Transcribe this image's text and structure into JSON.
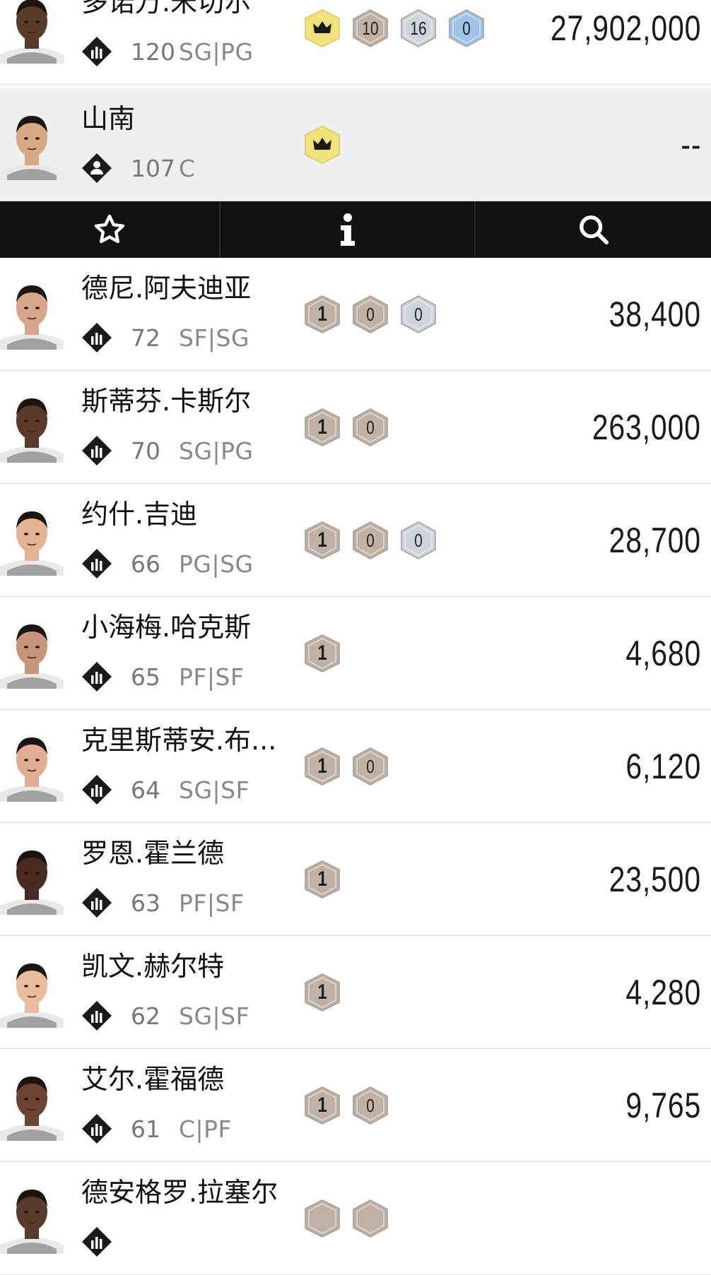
{
  "toolbar": {
    "buttons": [
      {
        "name": "favorite-star-icon"
      },
      {
        "name": "info-icon"
      },
      {
        "name": "search-icon"
      }
    ]
  },
  "colors": {
    "toolbar_bg": "#111111",
    "crown_badge": "#f2e27a",
    "bronze_badge": "#bfb1a6",
    "silver_badge": "#cfd3db",
    "gold_blue_badge": "#9ec3e6"
  },
  "players": [
    {
      "name": "多诺万.米切尔",
      "ovr": "120",
      "pos": "SG|PG",
      "role_icon": "bar-chart-icon",
      "badges": [
        {
          "type": "crown",
          "label": ""
        },
        {
          "type": "bronze",
          "label": "10"
        },
        {
          "type": "silver",
          "label": "16"
        },
        {
          "type": "blue",
          "label": "0"
        }
      ],
      "price": "27,902,000",
      "skin": "#5a3a28"
    },
    {
      "name": "山南",
      "ovr": "107",
      "pos": "C",
      "role_icon": "person-icon",
      "badges": [
        {
          "type": "crown",
          "label": ""
        }
      ],
      "price": "--",
      "skin": "#d9a982"
    },
    {
      "name": "德尼.阿夫迪亚",
      "ovr": "72",
      "pos": "SF|SG",
      "role_icon": "bar-chart-icon",
      "badges": [
        {
          "type": "tier1",
          "label": "1"
        },
        {
          "type": "bronze",
          "label": "0"
        },
        {
          "type": "silver",
          "label": "0"
        }
      ],
      "price": "38,400",
      "skin": "#d7a68a"
    },
    {
      "name": "斯蒂芬.卡斯尔",
      "ovr": "70",
      "pos": "SG|PG",
      "role_icon": "bar-chart-icon",
      "badges": [
        {
          "type": "tier1",
          "label": "1"
        },
        {
          "type": "bronze",
          "label": "0"
        }
      ],
      "price": "263,000",
      "skin": "#5b3a2a"
    },
    {
      "name": "约什.吉迪",
      "ovr": "66",
      "pos": "PG|SG",
      "role_icon": "bar-chart-icon",
      "badges": [
        {
          "type": "tier1",
          "label": "1"
        },
        {
          "type": "bronze",
          "label": "0"
        },
        {
          "type": "silver",
          "label": "0"
        }
      ],
      "price": "28,700",
      "skin": "#e3b394"
    },
    {
      "name": "小海梅.哈克斯",
      "ovr": "65",
      "pos": "PF|SF",
      "role_icon": "bar-chart-icon",
      "badges": [
        {
          "type": "tier1",
          "label": "1"
        }
      ],
      "price": "4,680",
      "skin": "#c9957a"
    },
    {
      "name": "克里斯蒂安.布...",
      "ovr": "64",
      "pos": "SG|SF",
      "role_icon": "bar-chart-icon",
      "badges": [
        {
          "type": "tier1",
          "label": "1"
        },
        {
          "type": "bronze",
          "label": "0"
        }
      ],
      "price": "6,120",
      "skin": "#e0ad92"
    },
    {
      "name": "罗恩.霍兰德",
      "ovr": "63",
      "pos": "PF|SF",
      "role_icon": "bar-chart-icon",
      "badges": [
        {
          "type": "tier1",
          "label": "1"
        }
      ],
      "price": "23,500",
      "skin": "#4a2b1f"
    },
    {
      "name": "凯文.赫尔特",
      "ovr": "62",
      "pos": "SG|SF",
      "role_icon": "bar-chart-icon",
      "badges": [
        {
          "type": "tier1",
          "label": "1"
        }
      ],
      "price": "4,280",
      "skin": "#eabd9f"
    },
    {
      "name": "艾尔.霍福德",
      "ovr": "61",
      "pos": "C|PF",
      "role_icon": "bar-chart-icon",
      "badges": [
        {
          "type": "tier1",
          "label": "1"
        },
        {
          "type": "bronze",
          "label": "0"
        }
      ],
      "price": "9,765",
      "skin": "#6b4330"
    },
    {
      "name": "德安格罗.拉塞尔",
      "ovr": "",
      "pos": "",
      "role_icon": "bar-chart-icon",
      "badges": [
        {
          "type": "tier1",
          "label": ""
        },
        {
          "type": "bronze",
          "label": ""
        }
      ],
      "price": "",
      "skin": "#5a3a2a"
    }
  ]
}
